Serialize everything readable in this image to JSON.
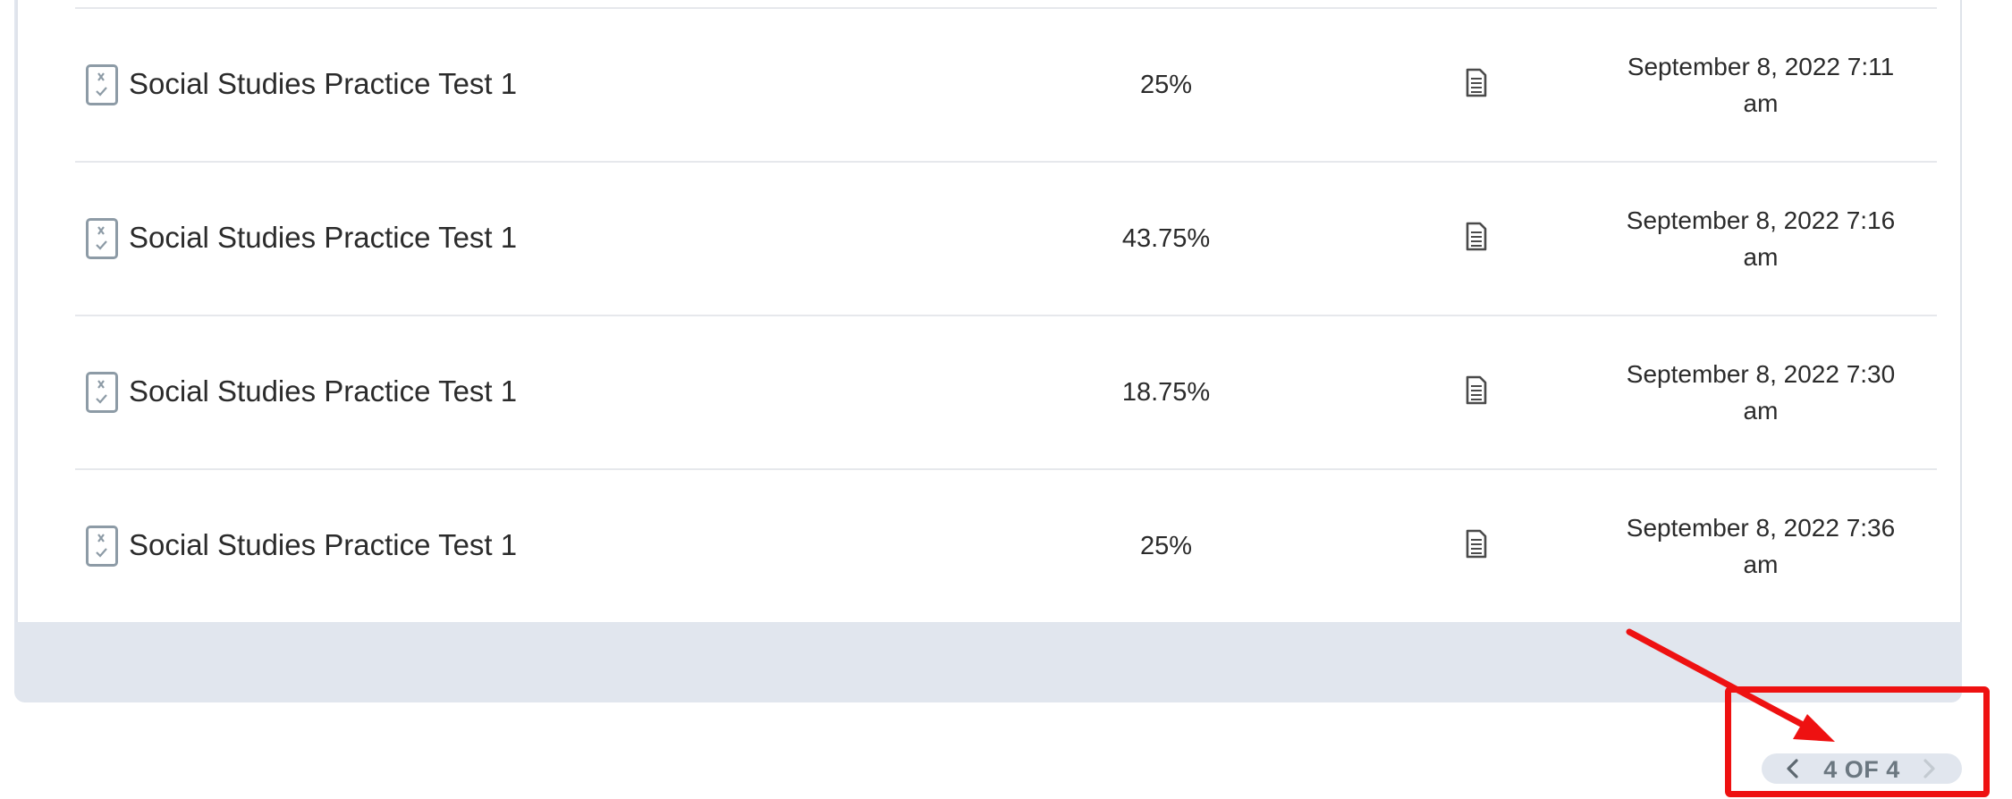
{
  "rows": [
    {
      "title": "Social Studies Practice Test 1",
      "score": "25%",
      "date_line1": "September 8, 2022 7:11",
      "date_line2": "am"
    },
    {
      "title": "Social Studies Practice Test 1",
      "score": "43.75%",
      "date_line1": "September 8, 2022 7:16",
      "date_line2": "am"
    },
    {
      "title": "Social Studies Practice Test 1",
      "score": "18.75%",
      "date_line1": "September 8, 2022 7:30",
      "date_line2": "am"
    },
    {
      "title": "Social Studies Practice Test 1",
      "score": "25%",
      "date_line1": "September 8, 2022 7:36",
      "date_line2": "am"
    }
  ],
  "icons": {
    "row_type": "quiz-icon",
    "row_action": "document-icon",
    "pager_prev": "chevron-left-icon",
    "pager_next": "chevron-right-icon"
  },
  "pagination": {
    "label": "4 OF 4"
  },
  "colors": {
    "annotation": "#ee1111",
    "panel": "#e1e6ee",
    "icon": "#8d9ba6"
  }
}
